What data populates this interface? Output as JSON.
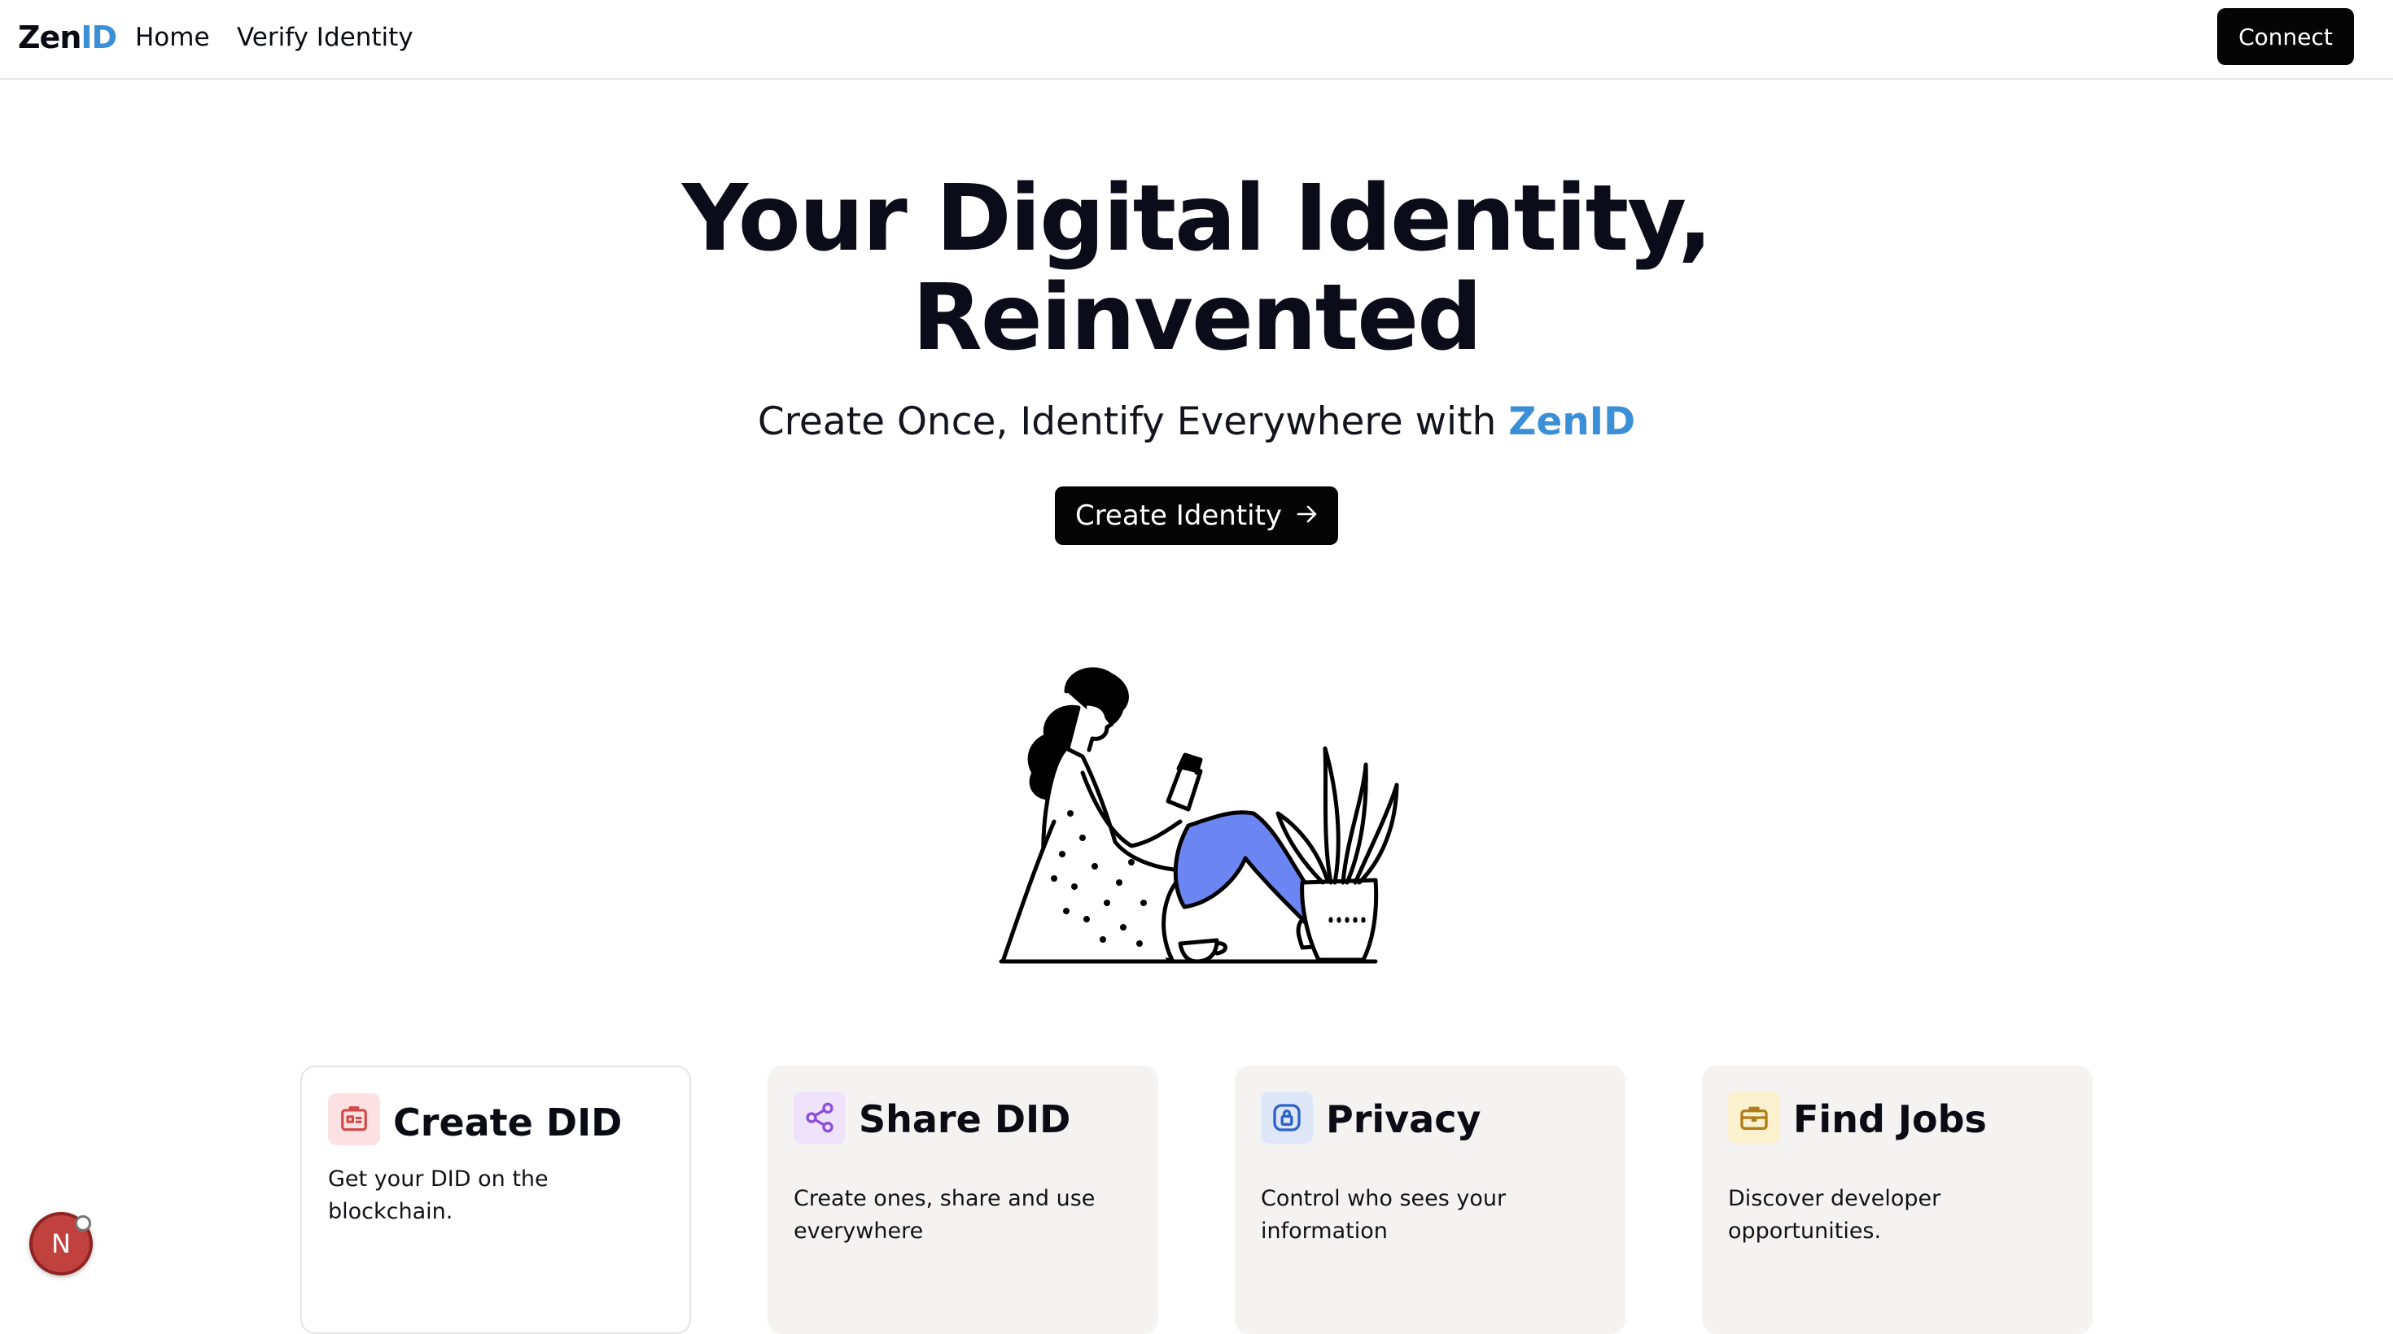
{
  "nav": {
    "logo_main": "Zen",
    "logo_accent": "ID",
    "links": [
      {
        "label": "Home"
      },
      {
        "label": "Verify Identity"
      }
    ],
    "connect_label": "Connect"
  },
  "hero": {
    "title_line1": "Your Digital Identity,",
    "title_line2": "Reinvented",
    "subtitle_prefix": "Create Once, Identify Everywhere with ",
    "subtitle_brand": "ZenID",
    "cta_label": "Create Identity",
    "cta_icon": "arrow-right-icon",
    "illustration": "woman-reading-with-plant"
  },
  "features": [
    {
      "title": "Create DID",
      "description": "Get your DID on the blockchain.",
      "icon": "id-card-icon",
      "icon_color": "#d24848",
      "icon_bg": "#fbe1e1"
    },
    {
      "title": "Share DID",
      "description": "Create ones, share and use everywhere",
      "icon": "share-icon",
      "icon_color": "#8b4fd8",
      "icon_bg": "#efe2fb"
    },
    {
      "title": "Privacy",
      "description": "Control who sees your information",
      "icon": "lock-icon",
      "icon_color": "#2f62c9",
      "icon_bg": "#dde7f8"
    },
    {
      "title": "Find Jobs",
      "description": "Discover developer opportunities.",
      "icon": "briefcase-icon",
      "icon_color": "#b07d1a",
      "icon_bg": "#fbf1cf"
    }
  ],
  "badge": {
    "label": "N"
  },
  "colors": {
    "brand_accent": "#3b8fd6",
    "button_bg": "#050505",
    "illustration_pants": "#6b86f2"
  }
}
